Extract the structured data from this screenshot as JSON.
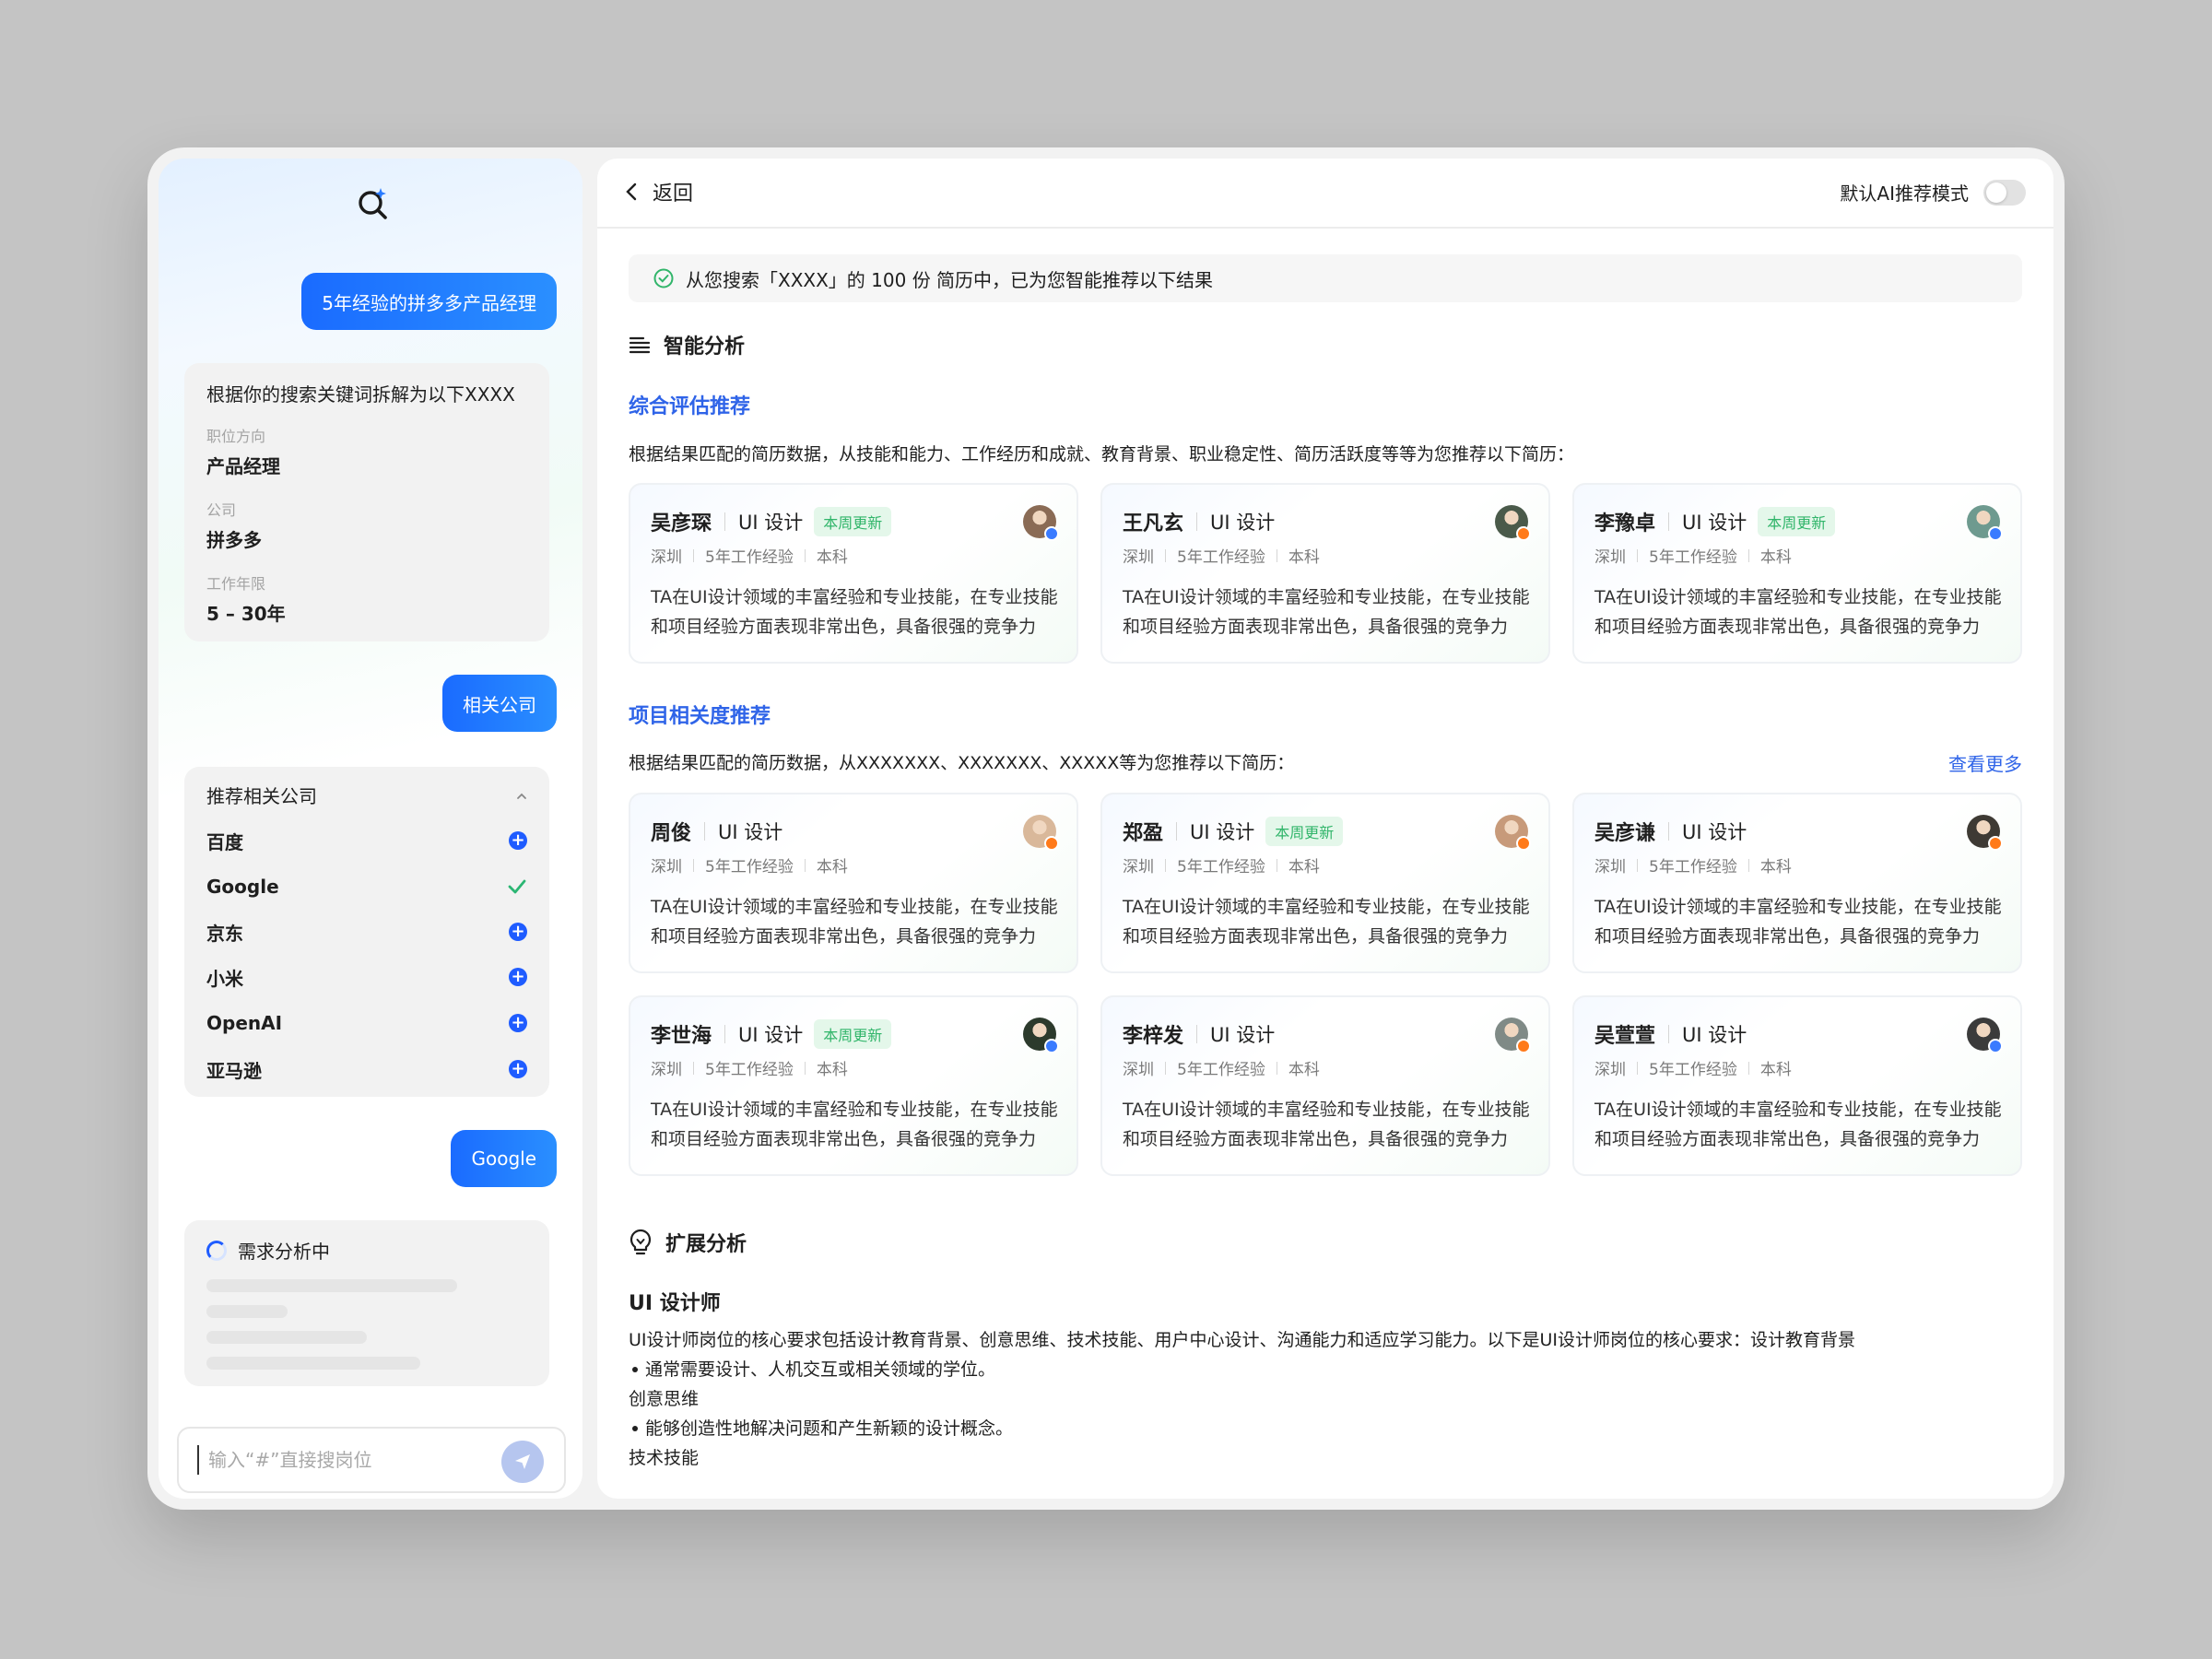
{
  "sidebar": {
    "query_bubble": "5年经验的拼多多产品经理",
    "keywords": {
      "title": "根据你的搜索关键词拆解为以下XXXX",
      "fields": [
        {
          "label": "职位方向",
          "value": "产品经理"
        },
        {
          "label": "公司",
          "value": "拼多多"
        },
        {
          "label": "工作年限",
          "value": "5 – 30年"
        }
      ]
    },
    "related_bubble": "相关公司",
    "companies": {
      "title": "推荐相关公司",
      "items": [
        {
          "name": "百度",
          "state": "add"
        },
        {
          "name": "Google",
          "state": "selected"
        },
        {
          "name": "京东",
          "state": "add"
        },
        {
          "name": "小米",
          "state": "add"
        },
        {
          "name": "OpenAI",
          "state": "add"
        },
        {
          "name": "亚马逊",
          "state": "add"
        }
      ]
    },
    "google_bubble": "Google",
    "analyzing_text": "需求分析中",
    "input_placeholder": "输入“#”直接搜岗位"
  },
  "main": {
    "back_label": "返回",
    "mode_label": "默认AI推荐模式",
    "mode_on": false,
    "notice": "从您搜索「XXXX」的 100 份 简历中，已为您智能推荐以下结果",
    "smart_title": "智能分析",
    "section1": {
      "title": "综合评估推荐",
      "desc": "根据结果匹配的简历数据，从技能和能力、工作经历和成就、教育背景、职业稳定性、简历活跃度等等为您推荐以下简历："
    },
    "section2": {
      "title": "项目相关度推荐",
      "desc": "根据结果匹配的简历数据，从XXXXXXX、XXXXXXX、XXXXX等为您推荐以下简历：",
      "more": "查看更多"
    },
    "candidates1": [
      {
        "name": "吴彦琛",
        "role": "UI 设计",
        "tag": "本周更新",
        "city": "深圳",
        "exp": "5年工作经验",
        "edu": "本科",
        "summary": "TA在UI设计领域的丰富经验和专业技能，在专业技能和项目经验方面表现非常出色，具备很强的竞争力",
        "dot": "#3a7bff",
        "face": "#8a6b55"
      },
      {
        "name": "王凡玄",
        "role": "UI 设计",
        "tag": "",
        "city": "深圳",
        "exp": "5年工作经验",
        "edu": "本科",
        "summary": "TA在UI设计领域的丰富经验和专业技能，在专业技能和项目经验方面表现非常出色，具备很强的竞争力",
        "dot": "#ff7a1a",
        "face": "#4a5a4a"
      },
      {
        "name": "李豫卓",
        "role": "UI 设计",
        "tag": "本周更新",
        "city": "深圳",
        "exp": "5年工作经验",
        "edu": "本科",
        "summary": "TA在UI设计领域的丰富经验和专业技能，在专业技能和项目经验方面表现非常出色，具备很强的竞争力",
        "dot": "#3a7bff",
        "face": "#6e9a8f"
      }
    ],
    "candidates2": [
      {
        "name": "周俊",
        "role": "UI 设计",
        "tag": "",
        "city": "深圳",
        "exp": "5年工作经验",
        "edu": "本科",
        "summary": "TA在UI设计领域的丰富经验和专业技能，在专业技能和项目经验方面表现非常出色，具备很强的竞争力",
        "dot": "#ff7a1a",
        "face": "#d9b89a"
      },
      {
        "name": "郑盈",
        "role": "UI 设计",
        "tag": "本周更新",
        "city": "深圳",
        "exp": "5年工作经验",
        "edu": "本科",
        "summary": "TA在UI设计领域的丰富经验和专业技能，在专业技能和项目经验方面表现非常出色，具备很强的竞争力",
        "dot": "#ff7a1a",
        "face": "#c79a7a"
      },
      {
        "name": "吴彦谦",
        "role": "UI 设计",
        "tag": "",
        "city": "深圳",
        "exp": "5年工作经验",
        "edu": "本科",
        "summary": "TA在UI设计领域的丰富经验和专业技能，在专业技能和项目经验方面表现非常出色，具备很强的竞争力",
        "dot": "#ff7a1a",
        "face": "#3e3a34"
      },
      {
        "name": "李世海",
        "role": "UI 设计",
        "tag": "本周更新",
        "city": "深圳",
        "exp": "5年工作经验",
        "edu": "本科",
        "summary": "TA在UI设计领域的丰富经验和专业技能，在专业技能和项目经验方面表现非常出色，具备很强的竞争力",
        "dot": "#3a7bff",
        "face": "#2c3a2c"
      },
      {
        "name": "李梓发",
        "role": "UI 设计",
        "tag": "",
        "city": "深圳",
        "exp": "5年工作经验",
        "edu": "本科",
        "summary": "TA在UI设计领域的丰富经验和专业技能，在专业技能和项目经验方面表现非常出色，具备很强的竞争力",
        "dot": "#ff7a1a",
        "face": "#7f8a86"
      },
      {
        "name": "吴萱萱",
        "role": "UI 设计",
        "tag": "",
        "city": "深圳",
        "exp": "5年工作经验",
        "edu": "本科",
        "summary": "TA在UI设计领域的丰富经验和专业技能，在专业技能和项目经验方面表现非常出色，具备很强的竞争力",
        "dot": "#3a7bff",
        "face": "#3b3b3b"
      }
    ],
    "ext_title": "扩展分析",
    "ext_sub": "UI 设计师",
    "ext_lines": [
      {
        "text": "UI设计师岗位的核心要求包括设计教育背景、创意思维、技术技能、用户中心设计、沟通能力和适应学习能力。以下是UI设计师岗位的核心要求：设计教育背景",
        "bullet": false
      },
      {
        "text": "通常需要设计、人机交互或相关领域的学位。",
        "bullet": true
      },
      {
        "text": "创意思维",
        "bullet": false
      },
      {
        "text": "能够创造性地解决问题和产生新颖的设计概念。",
        "bullet": true
      },
      {
        "text": "技术技能",
        "bullet": false
      }
    ]
  },
  "colors": {
    "accent": "#2f64e8",
    "bubble": "#1a6bff",
    "tag_green": "#31b56a"
  }
}
